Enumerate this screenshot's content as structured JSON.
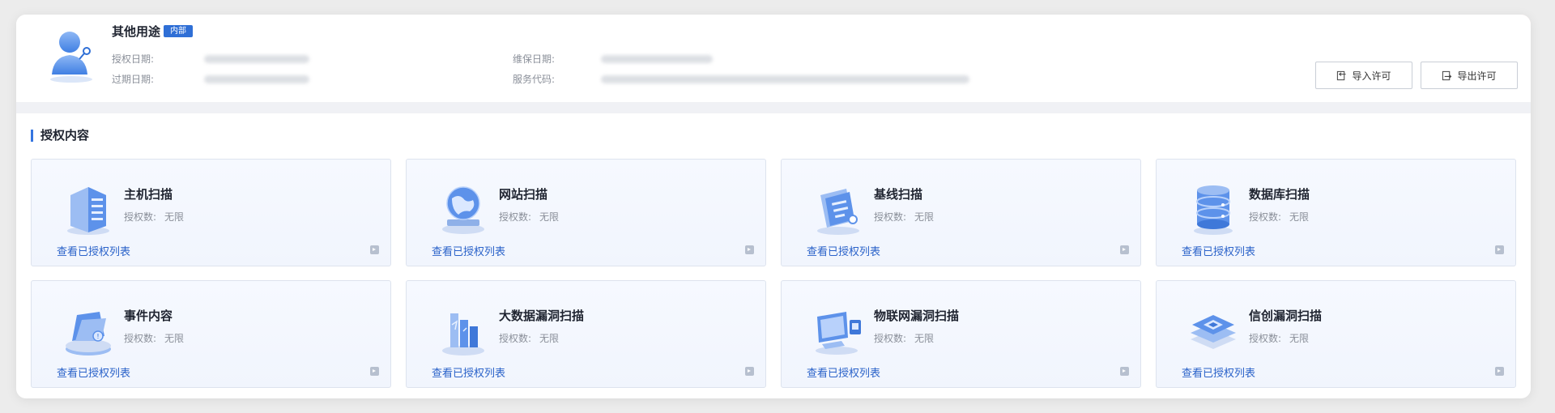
{
  "header": {
    "title": "其他用途",
    "badge": "内部",
    "fields": {
      "auth_date_label": "授权日期:",
      "expire_date_label": "过期日期:",
      "maintenance_date_label": "维保日期:",
      "service_code_label": "服务代码:"
    },
    "buttons": {
      "import_label": "导入许可",
      "export_label": "导出许可"
    }
  },
  "section": {
    "title": "授权内容"
  },
  "cards": [
    {
      "name": "主机扫描",
      "count_label": "授权数:",
      "count_value": "无限",
      "link": "查看已授权列表",
      "icon": "server-icon"
    },
    {
      "name": "网站扫描",
      "count_label": "授权数:",
      "count_value": "无限",
      "link": "查看已授权列表",
      "icon": "globe-icon"
    },
    {
      "name": "基线扫描",
      "count_label": "授权数:",
      "count_value": "无限",
      "link": "查看已授权列表",
      "icon": "baseline-icon"
    },
    {
      "name": "数据库扫描",
      "count_label": "授权数:",
      "count_value": "无限",
      "link": "查看已授权列表",
      "icon": "database-icon"
    },
    {
      "name": "事件内容",
      "count_label": "授权数:",
      "count_value": "无限",
      "link": "查看已授权列表",
      "icon": "event-folder-icon"
    },
    {
      "name": "大数据漏洞扫描",
      "count_label": "授权数:",
      "count_value": "无限",
      "link": "查看已授权列表",
      "icon": "bigdata-icon"
    },
    {
      "name": "物联网漏洞扫描",
      "count_label": "授权数:",
      "count_value": "无限",
      "link": "查看已授权列表",
      "icon": "iot-icon"
    },
    {
      "name": "信创漏洞扫描",
      "count_label": "授权数:",
      "count_value": "无限",
      "link": "查看已授权列表",
      "icon": "chip-stack-icon"
    }
  ],
  "colors": {
    "accent": "#2f6fd6",
    "link": "#2a62c9",
    "card_bg": "#f3f7fe"
  }
}
